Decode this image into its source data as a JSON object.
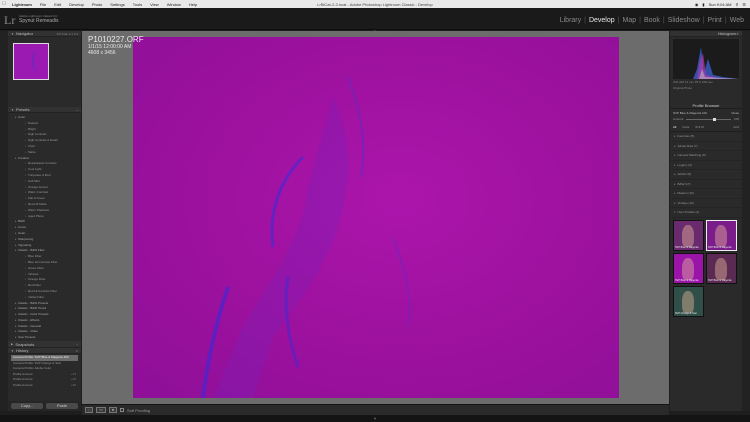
{
  "menubar": {
    "app_name": "Lightroom",
    "items": [
      "File",
      "Edit",
      "Develop",
      "Photo",
      "Settings",
      "Tools",
      "View",
      "Window",
      "Help"
    ],
    "document_title": "LrBlCat-2-3.lrcat - Adobe Photoshop Lightroom Classic - Develop",
    "clock": "Sun 9:04 AM"
  },
  "identity_plate": {
    "logo": "Lr",
    "subtitle": "Adobe Lightroom Classic CC",
    "name": "Spynut Remeadis"
  },
  "modules": [
    {
      "label": "Library",
      "active": false
    },
    {
      "label": "Develop",
      "active": true
    },
    {
      "label": "Map",
      "active": false
    },
    {
      "label": "Book",
      "active": false
    },
    {
      "label": "Slideshow",
      "active": false
    },
    {
      "label": "Print",
      "active": false
    },
    {
      "label": "Web",
      "active": false
    }
  ],
  "left_panel": {
    "navigator": {
      "title": "Navigator",
      "zoom": "FIT  FILL  1:1  3:1"
    },
    "presets": {
      "title": "Presets",
      "items": [
        {
          "label": "Color",
          "level": 0
        },
        {
          "label": "Natural",
          "level": 1
        },
        {
          "label": "Bright",
          "level": 1
        },
        {
          "label": "High Contrast",
          "level": 1
        },
        {
          "label": "High Contrast & Detail",
          "level": 1
        },
        {
          "label": "Vivid",
          "level": 1
        },
        {
          "label": "Matte",
          "level": 1
        },
        {
          "label": "Creative",
          "level": 0
        },
        {
          "label": "Desaturated Contrast",
          "level": 1
        },
        {
          "label": "Cool Light",
          "level": 1
        },
        {
          "label": "Turquoise & Red",
          "level": 1
        },
        {
          "label": "Soft Mist",
          "level": 1
        },
        {
          "label": "Orange Accent",
          "level": 1
        },
        {
          "label": "Warm Contrast",
          "level": 1
        },
        {
          "label": "Flat & Green",
          "level": 1
        },
        {
          "label": "Red Lift Matte",
          "level": 1
        },
        {
          "label": "Warm Shadows",
          "level": 1
        },
        {
          "label": "Aged Photo",
          "level": 1
        },
        {
          "label": "B&W",
          "level": 0
        },
        {
          "label": "Curve",
          "level": 0
        },
        {
          "label": "Grain",
          "level": 0
        },
        {
          "label": "Sharpening",
          "level": 0
        },
        {
          "label": "Vignetting",
          "level": 0
        },
        {
          "label": "Classic - B&W Filter",
          "level": 0
        },
        {
          "label": "Blue Filter",
          "level": 1
        },
        {
          "label": "Blue Hi-Contrast Filter",
          "level": 1
        },
        {
          "label": "Green Filter",
          "level": 1
        },
        {
          "label": "Infrared",
          "level": 1
        },
        {
          "label": "Orange Filter",
          "level": 1
        },
        {
          "label": "Red Filter",
          "level": 1
        },
        {
          "label": "Red Hi-Contrast Filter",
          "level": 1
        },
        {
          "label": "Yellow Filter",
          "level": 1
        },
        {
          "label": "Classic - B&W Presets",
          "level": 0
        },
        {
          "label": "Classic - B&W Toned",
          "level": 0
        },
        {
          "label": "Classic - Color Presets",
          "level": 0
        },
        {
          "label": "Classic - Effects",
          "level": 0
        },
        {
          "label": "Classic - General",
          "level": 0
        },
        {
          "label": "Classic - Video",
          "level": 0
        },
        {
          "label": "User Presets",
          "level": 0
        },
        {
          "label": "Orange & Matte",
          "level": 1
        }
      ]
    },
    "snapshots": {
      "title": "Snapshots"
    },
    "history": {
      "title": "History",
      "items": [
        {
          "label": "Camera Profile: SVP Blue & Magenta 100",
          "value": "",
          "selected": true
        },
        {
          "label": "Camera Profile: SVP Orange & Teal",
          "value": "",
          "selected": false
        },
        {
          "label": "Camera Profile: Adobe Color",
          "value": "",
          "selected": false
        },
        {
          "label": "Profile Amount",
          "value": "+14",
          "selected": false
        },
        {
          "label": "Profile Amount",
          "value": "+25",
          "selected": false
        },
        {
          "label": "Profile Amount",
          "value": "+30",
          "selected": false
        }
      ]
    },
    "copy_label": "Copy...",
    "paste_label": "Paste"
  },
  "photo": {
    "filename": "P1010227.ORF",
    "datetime": "1/1/15 12:00:00 AM",
    "dimensions": "4608 x 3456"
  },
  "toolbar": {
    "soft_proofing_label": "Soft Proofing"
  },
  "right_panel": {
    "histogram": {
      "title": "Histogram",
      "readout": "ISO 200   14 mm   f/5.6   1/60 sec",
      "label": "Original Photo"
    },
    "profile_browser": {
      "title": "Profile Browser",
      "current_profile": "SVP Blue & Magenta 100",
      "close_label": "Close",
      "amount_label": "Amount",
      "amount_value": "100",
      "tabs": [
        "All",
        "Color",
        "B & W"
      ],
      "grid_label": "Grid",
      "groups": [
        "Favorites (5)",
        "Adobe Raw (7)",
        "Camera Matching (9)",
        "Legacy (4)",
        "Artistic (8)",
        "B&W (17)",
        "Modern (10)",
        "Vintage (10)",
        "User Profiles (4)"
      ],
      "thumbnails": [
        {
          "label": "SVP Blue & Magenta",
          "color": "#6a2a6e",
          "selected": false
        },
        {
          "label": "SVP Blue & Magenta",
          "color": "#7a1c8a",
          "selected": true
        },
        {
          "label": "SVP Blue & Magenta",
          "color": "#9a14a8",
          "selected": false
        },
        {
          "label": "SVP Blue & Magenta",
          "color": "#5a2a52",
          "selected": false
        },
        {
          "label": "SVP Orange & Teal",
          "color": "#2f4f48",
          "selected": false
        }
      ]
    }
  }
}
